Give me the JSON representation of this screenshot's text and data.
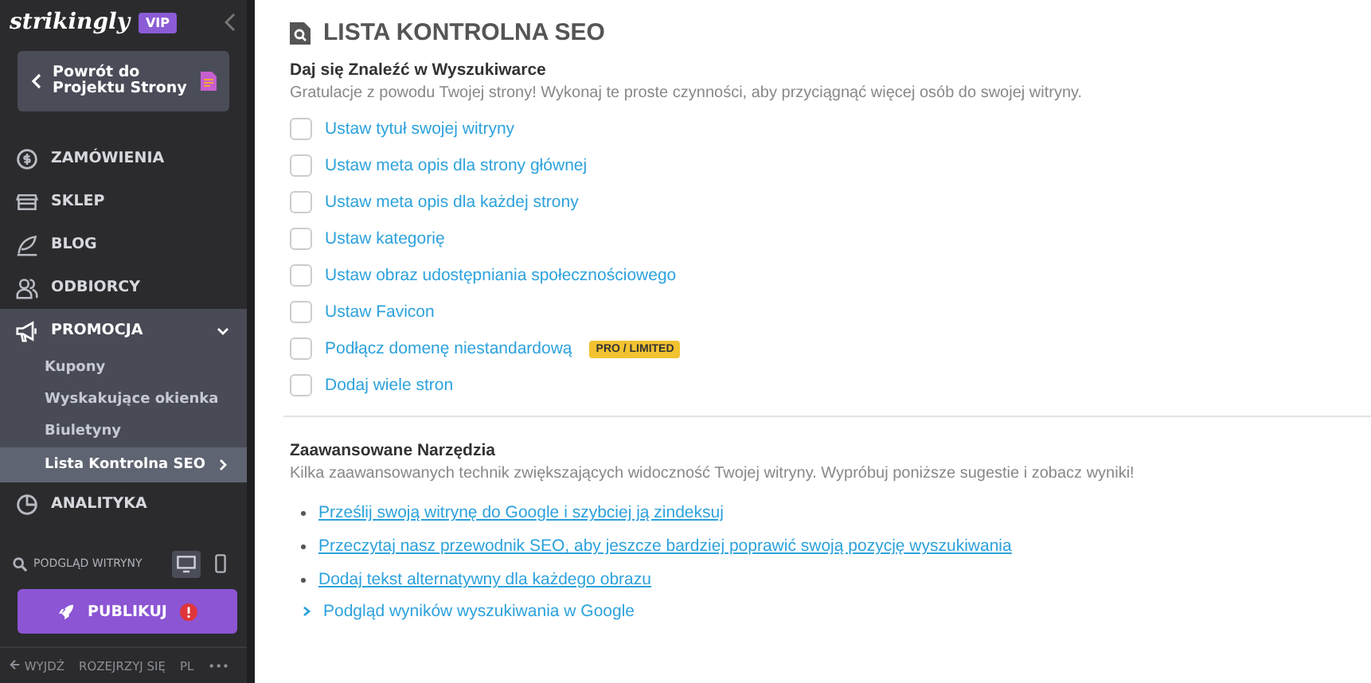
{
  "sidebar": {
    "logo": "strikingly",
    "badge": "VIP",
    "back_button": {
      "label": "Powrót do Projektu Strony"
    },
    "nav": [
      {
        "kind": "orders",
        "label": "ZAMÓWIENIA",
        "expanded": false
      },
      {
        "kind": "store",
        "label": "SKLEP",
        "expanded": false
      },
      {
        "kind": "blog",
        "label": "BLOG",
        "expanded": false
      },
      {
        "kind": "audience",
        "label": "ODBIORCY",
        "expanded": false
      },
      {
        "kind": "promo",
        "label": "PROMOCJA",
        "expanded": true,
        "children": [
          {
            "label": "Kupony",
            "selected": false
          },
          {
            "label": "Wyskakujące okienka",
            "selected": false
          },
          {
            "label": "Biuletyny",
            "selected": false
          },
          {
            "label": "Lista Kontrolna SEO",
            "selected": true
          }
        ]
      },
      {
        "kind": "analytics",
        "label": "ANALITYKA",
        "expanded": false
      }
    ],
    "preview": {
      "label": "PODGLĄD WITRYNY",
      "devices": [
        {
          "kind": "desktop",
          "selected": true
        },
        {
          "kind": "mobile",
          "selected": false
        }
      ]
    },
    "publish_button": {
      "label": "PUBLIKUJ",
      "alert": true
    },
    "footer": [
      "WYJDŹ",
      "ROZEJRZYJ SIĘ",
      "PL",
      "•••"
    ]
  },
  "main": {
    "title": "LISTA KONTROLNA SEO",
    "section1": {
      "heading": "Daj się Znaleźć w Wyszukiwarce",
      "description": "Gratulacje z powodu Twojej strony! Wykonaj te proste czynności, aby przyciągnąć więcej osób do swojej witryny.",
      "checklist": [
        {
          "label": "Ustaw tytuł swojej witryny",
          "checked": false
        },
        {
          "label": "Ustaw meta opis dla strony głównej",
          "checked": false
        },
        {
          "label": "Ustaw meta opis dla każdej strony",
          "checked": false
        },
        {
          "label": "Ustaw kategorię",
          "checked": false
        },
        {
          "label": "Ustaw obraz udostępniania społecznościowego",
          "checked": false
        },
        {
          "label": "Ustaw Favicon",
          "checked": false
        },
        {
          "label": "Podłącz domenę niestandardową",
          "checked": false,
          "badge": "PRO / LIMITED"
        },
        {
          "label": "Dodaj wiele stron",
          "checked": false
        }
      ]
    },
    "section2": {
      "heading": "Zaawansowane Narzędzia",
      "description": "Kilka zaawansowanych technik zwiększających widoczność Twojej witryny. Wypróbuj poniższe sugestie i zobacz wyniki!",
      "links": [
        "Prześlij swoją witrynę do Google i szybciej ją zindeksuj",
        "Przeczytaj nasz przewodnik SEO, aby jeszcze bardziej poprawić swoją pozycję wyszukiwania",
        "Dodaj tekst alternatywny dla każdego obrazu"
      ],
      "expander": {
        "label": "Podgląd wyników wyszukiwania w Google",
        "expanded": false
      }
    }
  }
}
